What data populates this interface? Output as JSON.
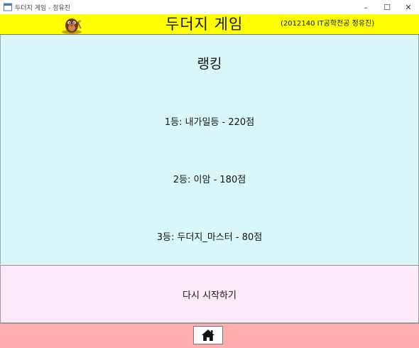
{
  "window": {
    "title": "두더지 게임 - 정유진",
    "minimize": "–",
    "maximize": "☐",
    "close": "✕"
  },
  "header": {
    "mascot_icon": "mole-mascot-icon",
    "title": "두더지 게임",
    "subtitle": "(2012140 IT공학전공 정유진)",
    "background": "#ffff00"
  },
  "ranking": {
    "title": "랭킹",
    "entries": [
      "1등: 내가일등 - 220점",
      "2등: 이암 - 180점",
      "3등: 두더지_마스터 - 80점"
    ],
    "background": "#d9f7fb"
  },
  "restart": {
    "label": "다시 시작하기",
    "background": "#fde9f8"
  },
  "footer": {
    "home_icon": "home-icon",
    "background": "#ffadad"
  }
}
